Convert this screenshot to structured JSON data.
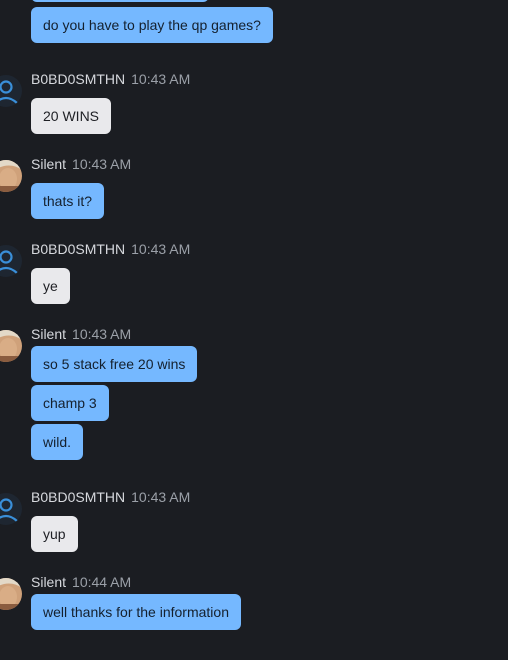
{
  "colors": {
    "background": "#1b1d22",
    "self_bubble": "#75b8ff",
    "other_bubble": "#e9e9ec",
    "default_avatar": "#3a8fd9"
  },
  "messages": [
    {
      "messages": [
        "do you have to play the qp games?"
      ]
    },
    {
      "author": "B0BD0SMTHN",
      "time": "10:43 AM",
      "avatar_icon": "default-user-icon",
      "messages": [
        "20 WINS"
      ]
    },
    {
      "author": "Silent",
      "time": "10:43 AM",
      "avatar_icon": "profile-photo",
      "messages": [
        "thats it?"
      ]
    },
    {
      "author": "B0BD0SMTHN",
      "time": "10:43 AM",
      "avatar_icon": "default-user-icon",
      "messages": [
        "ye"
      ]
    },
    {
      "author": "Silent",
      "time": "10:43 AM",
      "avatar_icon": "profile-photo",
      "messages": [
        "so 5 stack free 20 wins",
        "champ 3",
        "wild."
      ]
    },
    {
      "author": "B0BD0SMTHN",
      "time": "10:43 AM",
      "avatar_icon": "default-user-icon",
      "messages": [
        "yup"
      ]
    },
    {
      "author": "Silent",
      "time": "10:44 AM",
      "avatar_icon": "profile-photo",
      "messages": [
        "well thanks for the information"
      ]
    }
  ]
}
